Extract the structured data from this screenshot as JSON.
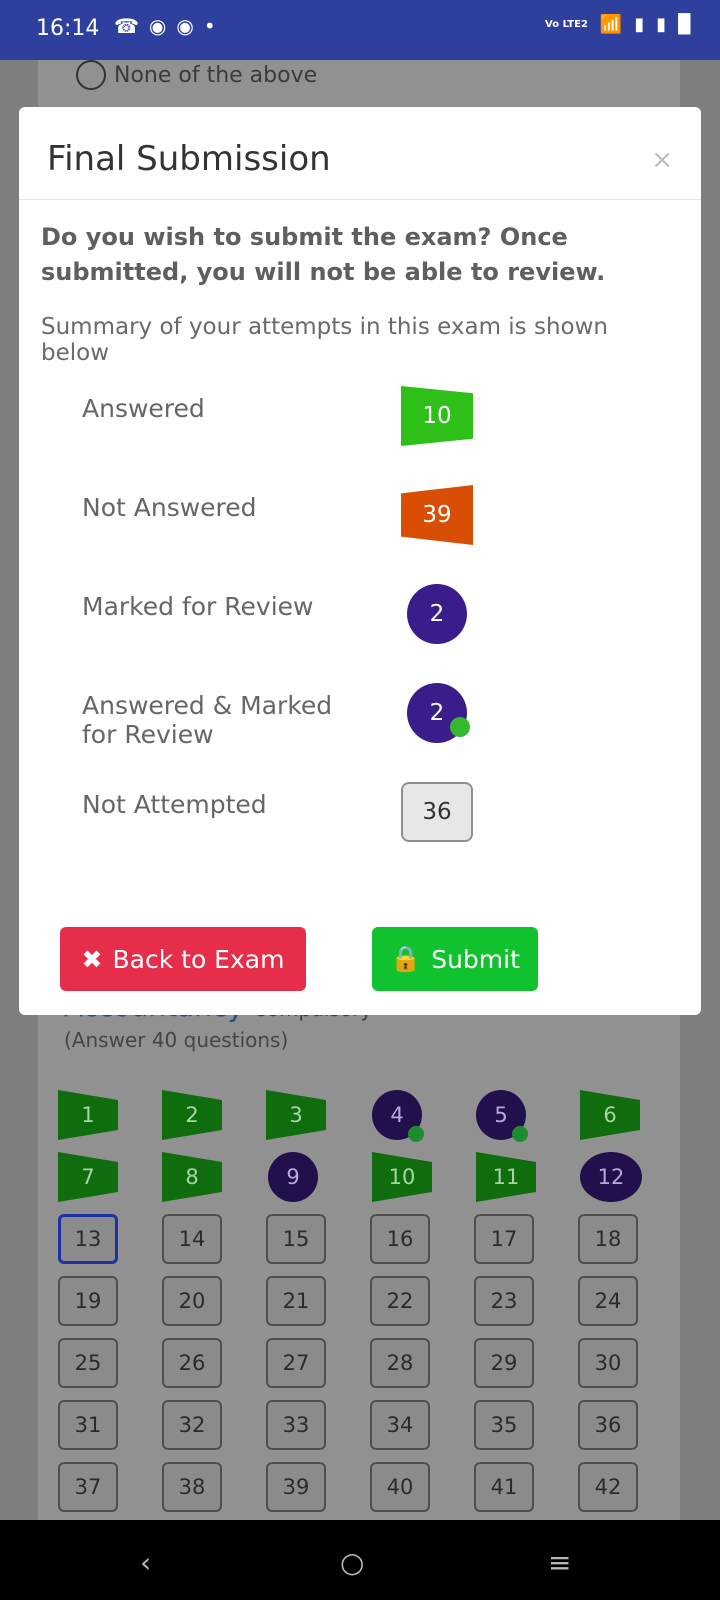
{
  "status": {
    "time": "16:14",
    "network_text": "Vo LTE2"
  },
  "background": {
    "option_text": "None of the above",
    "section_title": "Accountancy",
    "section_badge": "Compulsory",
    "section_note": "(Answer 40 questions)",
    "questions": [
      "1",
      "2",
      "3",
      "4",
      "5",
      "6",
      "7",
      "8",
      "9",
      "10",
      "11",
      "12",
      "13",
      "14",
      "15",
      "16",
      "17",
      "18",
      "19",
      "20",
      "21",
      "22",
      "23",
      "24",
      "25",
      "26",
      "27",
      "28",
      "29",
      "30",
      "31",
      "32",
      "33",
      "34",
      "35",
      "36",
      "37",
      "38",
      "39",
      "40",
      "41",
      "42"
    ]
  },
  "modal": {
    "title": "Final Submission",
    "close_label": "×",
    "lead": "Do you wish to submit the exam? Once submitted, you will not be able to review.",
    "summary_note": "Summary of your attempts in this exam is shown below",
    "rows": [
      {
        "label": "Answered",
        "value": "10"
      },
      {
        "label": "Not Answered",
        "value": "39"
      },
      {
        "label": "Marked for Review",
        "value": "2"
      },
      {
        "label": "Answered & Marked for Review",
        "value": "2"
      },
      {
        "label": "Not Attempted",
        "value": "36"
      }
    ],
    "back_label": "Back to Exam",
    "submit_label": "Submit"
  },
  "colors": {
    "answered": "#2fbf19",
    "not_answered": "#d94e05",
    "review": "#3a1d8b",
    "submit": "#10c32e",
    "back": "#e62e4b"
  }
}
